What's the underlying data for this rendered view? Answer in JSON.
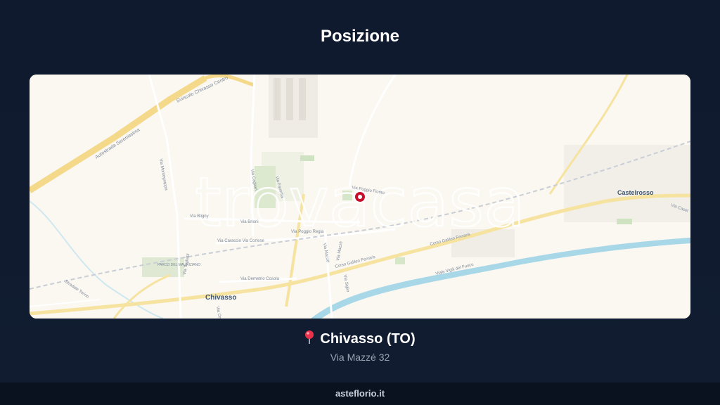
{
  "page": {
    "title": "Posizione"
  },
  "map": {
    "watermark": "trovacasa",
    "places": [
      {
        "name": "Chivasso",
        "kind": "town"
      },
      {
        "name": "Castelrosso",
        "kind": "town"
      }
    ],
    "streets": [
      "Autostrada Serenissima",
      "Svincolo Chivasso Centro",
      "Via Montegrappa",
      "Via Cagliari",
      "Via Favorita",
      "Via Mazzè",
      "Via Poggio Fiorito",
      "Via Bligny",
      "Via Brioni",
      "Via Caraccio Via Cortese",
      "Via Poggio Regia",
      "Via Mazzè",
      "Corso Galileo Ferraris",
      "Corso Galileo Ferraris",
      "Via Demetrio Cosola",
      "Viale Vigili del Fuoco",
      "Stradale Torino",
      "Via Togliatti",
      "Via Orsini",
      "Via Siglio",
      "Via Casel"
    ],
    "park": "PARCO DEL MAURIZIANO",
    "marker": "property-location-marker"
  },
  "location": {
    "city": "Chivasso (TO)",
    "address": "Via Mazzé 32",
    "pin_icon": "red-pin-icon"
  },
  "footer": {
    "site": "asteflorio.it"
  },
  "colors": {
    "background": "#0f1a2e",
    "map_base": "#fbf7f1",
    "river": "#a8d8e8",
    "marker": "#c8102e"
  }
}
